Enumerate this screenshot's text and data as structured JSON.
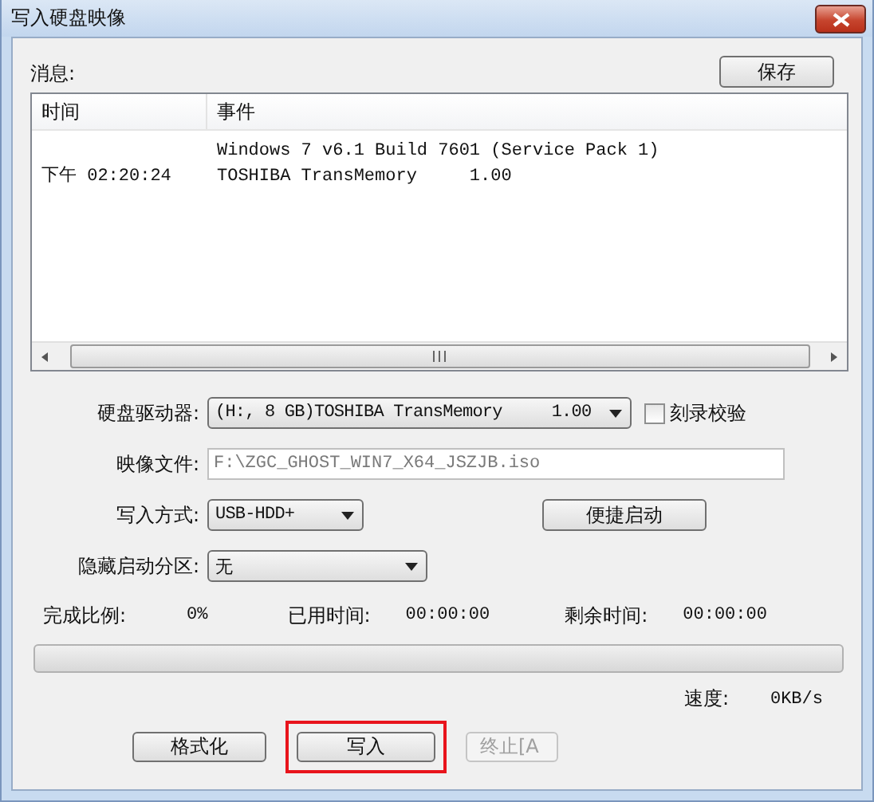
{
  "window": {
    "title": "写入硬盘映像"
  },
  "messages": {
    "label": "消息:",
    "save_button": "保存",
    "columns": [
      "时间",
      "事件"
    ],
    "rows": [
      {
        "event": "Windows 7 v6.1 Build 7601 (Service Pack 1)"
      },
      {
        "time": "下午 02:20:24",
        "event": "TOSHIBA TransMemory     1.00"
      }
    ]
  },
  "fields": [
    {
      "kind": "combo",
      "label": "硬盘驱动器:",
      "value": "(H:, 8 GB)TOSHIBA TransMemory     1.00",
      "checkbox": {
        "label": "刻录校验",
        "checked": false
      }
    },
    {
      "kind": "text",
      "label": "映像文件:",
      "value": "F:\\ZGC_GHOST_WIN7_X64_JSZJB.iso",
      "disabled": true
    },
    {
      "kind": "combo",
      "label": "写入方式:",
      "value": "USB-HDD+",
      "button": "便捷启动"
    },
    {
      "kind": "combo",
      "label": "隐藏启动分区:",
      "value": "无"
    }
  ],
  "stats": [
    {
      "label": "完成比例:",
      "value": "0%"
    },
    {
      "label": "已用时间:",
      "value": "00:00:00"
    },
    {
      "label": "剩余时间:",
      "value": "00:00:00"
    }
  ],
  "progress": {
    "level": 0
  },
  "speed": {
    "label": "速度:",
    "value": "0KB/s"
  },
  "buttons": [
    {
      "label": "格式化",
      "disabled": false,
      "highlighted": false
    },
    {
      "label": "写入",
      "disabled": false,
      "highlighted": true
    },
    {
      "label": "终止[A",
      "disabled": true,
      "highlighted": false
    }
  ]
}
